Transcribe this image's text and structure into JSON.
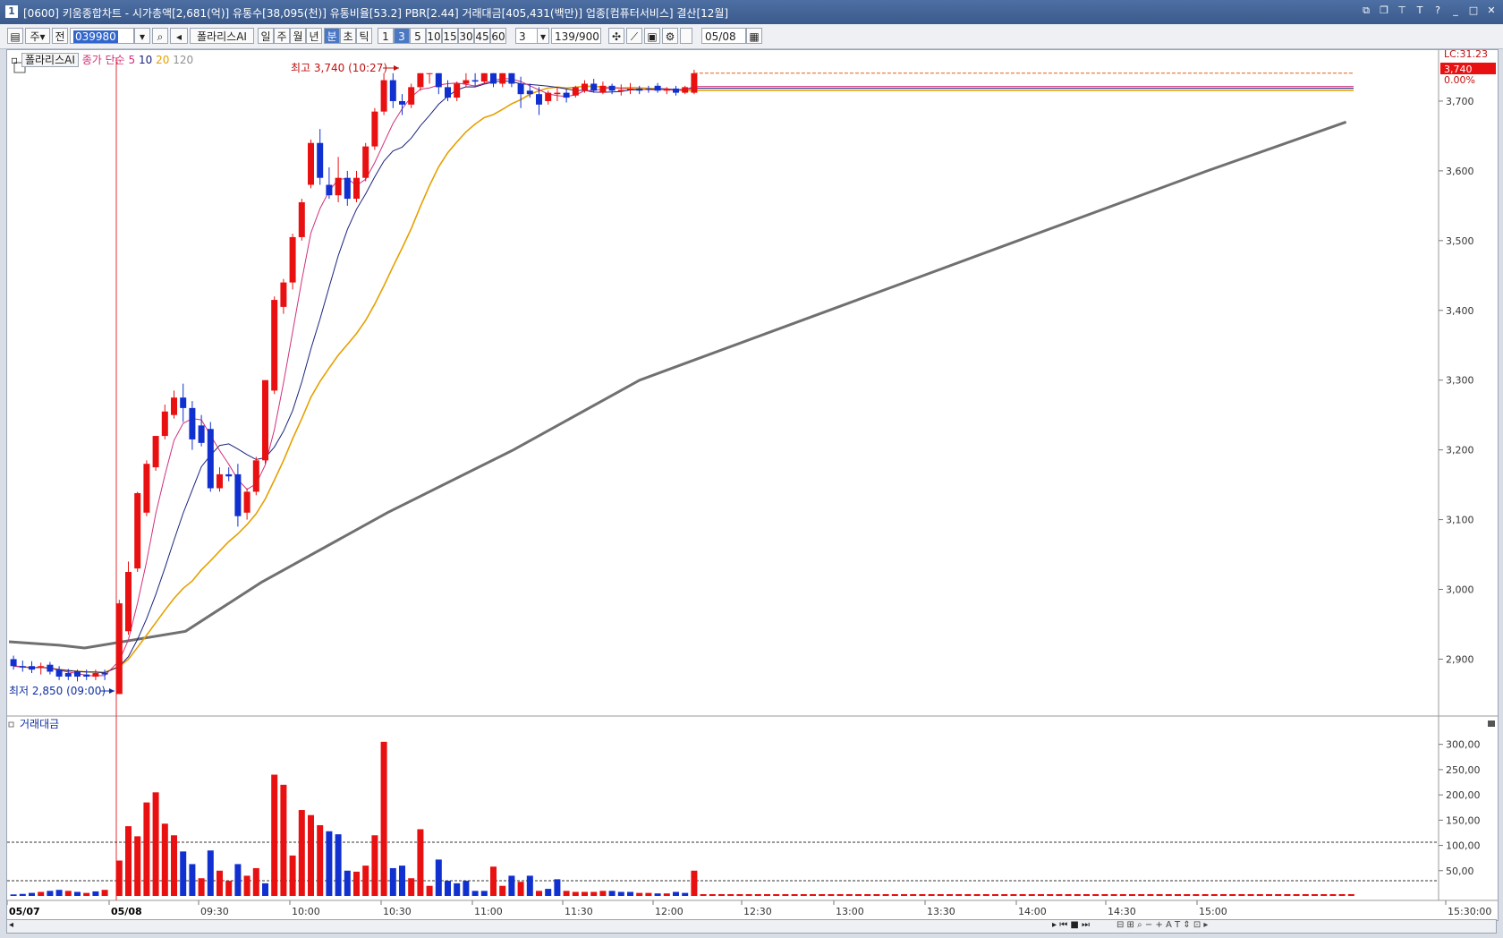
{
  "title": "[0600] 키움종합차트 - 시가총액[2,681(억)] 유통수[38,095(천)] 유통비율[53.2] PBR[2.44] 거래대금[405,431(백만)] 업종[컴퓨터서비스] 결산[12월]",
  "window_icon": "1",
  "toolbar": {
    "market": "주",
    "prev": "전",
    "code": "039980",
    "name": "폴라리스AI",
    "tabs": [
      "일",
      "주",
      "월",
      "년",
      "분",
      "초",
      "틱"
    ],
    "active_tab": "분",
    "intervals": [
      "1",
      "3",
      "5",
      "10",
      "15",
      "30",
      "45",
      "60"
    ],
    "active_interval": "3",
    "n_value": "3",
    "count": "139",
    "count_total": "/900",
    "date": "05/08"
  },
  "legend": {
    "name": "폴라리스AI",
    "ma_label": "종가 단순",
    "ma_periods": [
      {
        "label": "5",
        "color": "#d0307a"
      },
      {
        "label": "10",
        "color": "#1a237e"
      },
      {
        "label": "20",
        "color": "#e6a000"
      },
      {
        "label": "120",
        "color": "#707070"
      }
    ]
  },
  "volume_title": "거래대금",
  "annotations": {
    "high": "최고 3,740 (10:27)",
    "low": "최저 2,850 (09:00)"
  },
  "price_panel": {
    "lc": "LC:31.23",
    "current": "3,740",
    "change": "0.00%",
    "y_labels": [
      "3,700",
      "3,600",
      "3,500",
      "3,400",
      "3,300",
      "3,200",
      "3,100",
      "3,000",
      "2,900"
    ]
  },
  "volume_panel": {
    "y_labels": [
      "300,00",
      "250,00",
      "200,00",
      "150,00",
      "100,00",
      "50,00"
    ]
  },
  "x_labels": [
    "05/07",
    "05/08",
    "09:30",
    "10:00",
    "10:30",
    "11:00",
    "11:30",
    "12:00",
    "12:30",
    "13:00",
    "13:30",
    "14:00",
    "14:30",
    "15:00",
    "15:30:00"
  ],
  "chart_data": {
    "type": "candlestick",
    "interval": "3분",
    "ylim": [
      2830,
      3750
    ],
    "up_color": "#e81010",
    "down_color": "#1030d0",
    "candles": [
      {
        "o": 2900,
        "h": 2905,
        "l": 2885,
        "c": 2890
      },
      {
        "o": 2890,
        "h": 2898,
        "l": 2882,
        "c": 2888
      },
      {
        "o": 2890,
        "h": 2897,
        "l": 2880,
        "c": 2885
      },
      {
        "o": 2888,
        "h": 2895,
        "l": 2878,
        "c": 2890
      },
      {
        "o": 2892,
        "h": 2896,
        "l": 2878,
        "c": 2882
      },
      {
        "o": 2885,
        "h": 2890,
        "l": 2870,
        "c": 2875
      },
      {
        "o": 2880,
        "h": 2886,
        "l": 2870,
        "c": 2875
      },
      {
        "o": 2882,
        "h": 2885,
        "l": 2868,
        "c": 2875
      },
      {
        "o": 2878,
        "h": 2885,
        "l": 2870,
        "c": 2875
      },
      {
        "o": 2875,
        "h": 2885,
        "l": 2870,
        "c": 2880
      },
      {
        "o": 2880,
        "h": 2885,
        "l": 2870,
        "c": 2878
      },
      {
        "o": 2850,
        "h": 2985,
        "l": 2850,
        "c": 2980
      },
      {
        "o": 2940,
        "h": 3040,
        "l": 2935,
        "c": 3025
      },
      {
        "o": 3030,
        "h": 3140,
        "l": 3025,
        "c": 3138
      },
      {
        "o": 3110,
        "h": 3185,
        "l": 3105,
        "c": 3180
      },
      {
        "o": 3175,
        "h": 3220,
        "l": 3170,
        "c": 3220
      },
      {
        "o": 3220,
        "h": 3265,
        "l": 3215,
        "c": 3255
      },
      {
        "o": 3250,
        "h": 3285,
        "l": 3245,
        "c": 3275
      },
      {
        "o": 3275,
        "h": 3295,
        "l": 3240,
        "c": 3260
      },
      {
        "o": 3260,
        "h": 3270,
        "l": 3200,
        "c": 3215
      },
      {
        "o": 3235,
        "h": 3250,
        "l": 3205,
        "c": 3210
      },
      {
        "o": 3230,
        "h": 3240,
        "l": 3140,
        "c": 3145
      },
      {
        "o": 3145,
        "h": 3175,
        "l": 3140,
        "c": 3165
      },
      {
        "o": 3165,
        "h": 3175,
        "l": 3155,
        "c": 3162
      },
      {
        "o": 3165,
        "h": 3180,
        "l": 3090,
        "c": 3105
      },
      {
        "o": 3110,
        "h": 3145,
        "l": 3100,
        "c": 3140
      },
      {
        "o": 3140,
        "h": 3190,
        "l": 3135,
        "c": 3185
      },
      {
        "o": 3185,
        "h": 3300,
        "l": 3180,
        "c": 3300
      },
      {
        "o": 3285,
        "h": 3420,
        "l": 3280,
        "c": 3415
      },
      {
        "o": 3405,
        "h": 3445,
        "l": 3395,
        "c": 3440
      },
      {
        "o": 3440,
        "h": 3510,
        "l": 3430,
        "c": 3505
      },
      {
        "o": 3505,
        "h": 3560,
        "l": 3500,
        "c": 3555
      },
      {
        "o": 3580,
        "h": 3645,
        "l": 3575,
        "c": 3640
      },
      {
        "o": 3640,
        "h": 3660,
        "l": 3580,
        "c": 3590
      },
      {
        "o": 3580,
        "h": 3605,
        "l": 3560,
        "c": 3565
      },
      {
        "o": 3565,
        "h": 3620,
        "l": 3555,
        "c": 3590
      },
      {
        "o": 3590,
        "h": 3600,
        "l": 3550,
        "c": 3560
      },
      {
        "o": 3560,
        "h": 3600,
        "l": 3555,
        "c": 3590
      },
      {
        "o": 3590,
        "h": 3640,
        "l": 3585,
        "c": 3635
      },
      {
        "o": 3635,
        "h": 3690,
        "l": 3630,
        "c": 3685
      },
      {
        "o": 3685,
        "h": 3740,
        "l": 3680,
        "c": 3730
      },
      {
        "o": 3730,
        "h": 3740,
        "l": 3690,
        "c": 3700
      },
      {
        "o": 3700,
        "h": 3710,
        "l": 3680,
        "c": 3695
      },
      {
        "o": 3695,
        "h": 3725,
        "l": 3690,
        "c": 3720
      },
      {
        "o": 3720,
        "h": 3740,
        "l": 3715,
        "c": 3740
      },
      {
        "o": 3740,
        "h": 3740,
        "l": 3725,
        "c": 3740
      },
      {
        "o": 3740,
        "h": 3740,
        "l": 3710,
        "c": 3720
      },
      {
        "o": 3720,
        "h": 3730,
        "l": 3700,
        "c": 3705
      },
      {
        "o": 3705,
        "h": 3728,
        "l": 3700,
        "c": 3725
      },
      {
        "o": 3725,
        "h": 3740,
        "l": 3720,
        "c": 3730
      },
      {
        "o": 3730,
        "h": 3740,
        "l": 3722,
        "c": 3728
      },
      {
        "o": 3728,
        "h": 3740,
        "l": 3725,
        "c": 3740
      },
      {
        "o": 3740,
        "h": 3740,
        "l": 3720,
        "c": 3725
      },
      {
        "o": 3725,
        "h": 3740,
        "l": 3720,
        "c": 3740
      },
      {
        "o": 3740,
        "h": 3740,
        "l": 3720,
        "c": 3725
      },
      {
        "o": 3725,
        "h": 3735,
        "l": 3690,
        "c": 3710
      },
      {
        "o": 3715,
        "h": 3725,
        "l": 3705,
        "c": 3710
      },
      {
        "o": 3710,
        "h": 3720,
        "l": 3680,
        "c": 3695
      },
      {
        "o": 3700,
        "h": 3715,
        "l": 3695,
        "c": 3712
      },
      {
        "o": 3710,
        "h": 3720,
        "l": 3700,
        "c": 3712
      },
      {
        "o": 3712,
        "h": 3718,
        "l": 3698,
        "c": 3705
      },
      {
        "o": 3708,
        "h": 3722,
        "l": 3705,
        "c": 3720
      },
      {
        "o": 3715,
        "h": 3730,
        "l": 3712,
        "c": 3725
      },
      {
        "o": 3725,
        "h": 3732,
        "l": 3712,
        "c": 3715
      },
      {
        "o": 3712,
        "h": 3728,
        "l": 3710,
        "c": 3722
      },
      {
        "o": 3722,
        "h": 3725,
        "l": 3710,
        "c": 3715
      },
      {
        "o": 3714,
        "h": 3724,
        "l": 3708,
        "c": 3716
      },
      {
        "o": 3716,
        "h": 3726,
        "l": 3710,
        "c": 3718
      },
      {
        "o": 3718,
        "h": 3722,
        "l": 3710,
        "c": 3715
      },
      {
        "o": 3718,
        "h": 3722,
        "l": 3712,
        "c": 3717
      },
      {
        "o": 3722,
        "h": 3726,
        "l": 3712,
        "c": 3715
      },
      {
        "o": 3715,
        "h": 3720,
        "l": 3710,
        "c": 3718
      },
      {
        "o": 3718,
        "h": 3722,
        "l": 3708,
        "c": 3712
      },
      {
        "o": 3712,
        "h": 3722,
        "l": 3710,
        "c": 3720
      },
      {
        "o": 3712,
        "h": 3745,
        "l": 3710,
        "c": 3740
      }
    ],
    "volume": [
      {
        "v": 3,
        "up": false
      },
      {
        "v": 4,
        "up": false
      },
      {
        "v": 6,
        "up": false
      },
      {
        "v": 8,
        "up": true
      },
      {
        "v": 10,
        "up": false
      },
      {
        "v": 12,
        "up": false
      },
      {
        "v": 10,
        "up": true
      },
      {
        "v": 8,
        "up": false
      },
      {
        "v": 6,
        "up": true
      },
      {
        "v": 9,
        "up": false
      },
      {
        "v": 12,
        "up": true
      },
      {
        "v": 70,
        "up": true
      },
      {
        "v": 138,
        "up": true
      },
      {
        "v": 118,
        "up": true
      },
      {
        "v": 185,
        "up": true
      },
      {
        "v": 205,
        "up": true
      },
      {
        "v": 143,
        "up": true
      },
      {
        "v": 120,
        "up": true
      },
      {
        "v": 88,
        "up": false
      },
      {
        "v": 63,
        "up": false
      },
      {
        "v": 35,
        "up": true
      },
      {
        "v": 90,
        "up": false
      },
      {
        "v": 50,
        "up": true
      },
      {
        "v": 30,
        "up": true
      },
      {
        "v": 63,
        "up": false
      },
      {
        "v": 40,
        "up": true
      },
      {
        "v": 55,
        "up": true
      },
      {
        "v": 25,
        "up": false
      },
      {
        "v": 240,
        "up": true
      },
      {
        "v": 220,
        "up": true
      },
      {
        "v": 80,
        "up": true
      },
      {
        "v": 170,
        "up": true
      },
      {
        "v": 160,
        "up": true
      },
      {
        "v": 140,
        "up": true
      },
      {
        "v": 128,
        "up": false
      },
      {
        "v": 122,
        "up": false
      },
      {
        "v": 50,
        "up": false
      },
      {
        "v": 48,
        "up": true
      },
      {
        "v": 60,
        "up": true
      },
      {
        "v": 120,
        "up": true
      },
      {
        "v": 305,
        "up": true
      },
      {
        "v": 55,
        "up": false
      },
      {
        "v": 60,
        "up": false
      },
      {
        "v": 35,
        "up": true
      },
      {
        "v": 132,
        "up": true
      },
      {
        "v": 20,
        "up": true
      },
      {
        "v": 72,
        "up": false
      },
      {
        "v": 30,
        "up": false
      },
      {
        "v": 25,
        "up": false
      },
      {
        "v": 30,
        "up": false
      },
      {
        "v": 10,
        "up": false
      },
      {
        "v": 10,
        "up": false
      },
      {
        "v": 58,
        "up": true
      },
      {
        "v": 20,
        "up": true
      },
      {
        "v": 40,
        "up": false
      },
      {
        "v": 28,
        "up": true
      },
      {
        "v": 40,
        "up": false
      },
      {
        "v": 10,
        "up": true
      },
      {
        "v": 14,
        "up": false
      },
      {
        "v": 33,
        "up": false
      },
      {
        "v": 10,
        "up": true
      },
      {
        "v": 8,
        "up": true
      },
      {
        "v": 8,
        "up": true
      },
      {
        "v": 8,
        "up": true
      },
      {
        "v": 10,
        "up": true
      },
      {
        "v": 10,
        "up": false
      },
      {
        "v": 8,
        "up": false
      },
      {
        "v": 8,
        "up": false
      },
      {
        "v": 6,
        "up": true
      },
      {
        "v": 6,
        "up": true
      },
      {
        "v": 5,
        "up": false
      },
      {
        "v": 5,
        "up": true
      },
      {
        "v": 8,
        "up": false
      },
      {
        "v": 6,
        "up": false
      },
      {
        "v": 50,
        "up": true
      }
    ],
    "ma120_anchor": [
      {
        "x": 0,
        "y": 2925
      },
      {
        "x": 8,
        "y": 2920
      },
      {
        "x": 12,
        "y": 2916
      },
      {
        "x": 28,
        "y": 2940
      },
      {
        "x": 40,
        "y": 3010
      },
      {
        "x": 60,
        "y": 3110
      },
      {
        "x": 80,
        "y": 3200
      },
      {
        "x": 100,
        "y": 3300
      },
      {
        "x": 130,
        "y": 3400
      },
      {
        "x": 160,
        "y": 3500
      },
      {
        "x": 190,
        "y": 3600
      },
      {
        "x": 212,
        "y": 3670
      }
    ]
  }
}
